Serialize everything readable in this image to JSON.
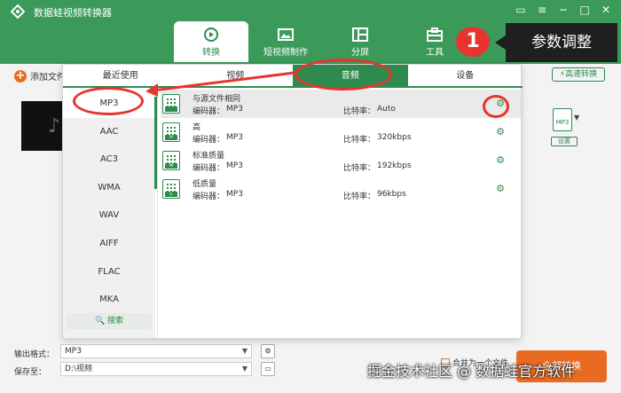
{
  "app": {
    "title": "数据蛙视频转换器"
  },
  "nav": {
    "items": [
      {
        "label": "转换",
        "icon": "convert-icon",
        "active": true
      },
      {
        "label": "短视频制作",
        "icon": "short-video-icon",
        "active": false
      },
      {
        "label": "分屏",
        "icon": "split-screen-icon",
        "active": false
      },
      {
        "label": "工具",
        "icon": "toolbox-icon",
        "active": false
      }
    ]
  },
  "annotation": {
    "step_number": "1",
    "callout": "参数调整"
  },
  "toolbar": {
    "add_file": "添加文件",
    "fast_convert": "高速转换"
  },
  "file": {
    "format_icon_label": "MP3",
    "settings_label": "设置"
  },
  "tabs": [
    "最近使用",
    "视频",
    "音频",
    "设备"
  ],
  "formats": [
    "MP3",
    "AAC",
    "AC3",
    "WMA",
    "WAV",
    "AIFF",
    "FLAC",
    "MKA"
  ],
  "search_label": "搜索",
  "presets": [
    {
      "title": "与源文件相同",
      "tag": "",
      "encoder_label": "编码器：",
      "encoder": "MP3",
      "bitrate_label": "比特率：",
      "bitrate": "Auto"
    },
    {
      "title": "高",
      "tag": "H",
      "encoder_label": "编码器：",
      "encoder": "MP3",
      "bitrate_label": "比特率：",
      "bitrate": "320kbps"
    },
    {
      "title": "标准质量",
      "tag": "M",
      "encoder_label": "编码器：",
      "encoder": "MP3",
      "bitrate_label": "比特率：",
      "bitrate": "192kbps"
    },
    {
      "title": "低质量",
      "tag": "L",
      "encoder_label": "编码器：",
      "encoder": "MP3",
      "bitrate_label": "比特率：",
      "bitrate": "96kbps"
    }
  ],
  "bottom": {
    "output_format_label": "输出格式：",
    "output_format_value": "MP3",
    "save_to_label": "保存至：",
    "save_to_value": "D:\\视频",
    "merge_label": "合并为一个文件",
    "convert_all": "全部转换"
  },
  "watermark": "掘金技术社区 @ 数据蛙官方软件",
  "colors": {
    "brand_green": "#2e8b4d",
    "header_green": "#3b9a5a",
    "accent_orange": "#e96b22",
    "annotation_red": "#e8342e"
  }
}
